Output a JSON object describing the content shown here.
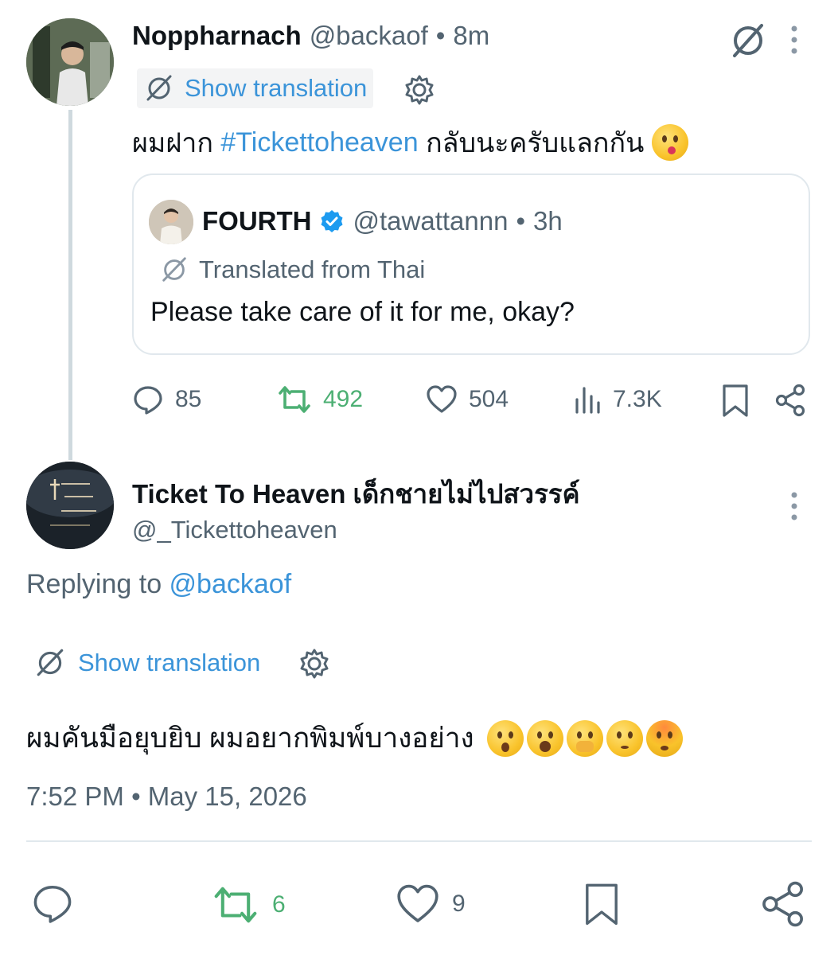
{
  "tweet1": {
    "display_name": "Noppharnach",
    "handle": "@backaof",
    "separator": "•",
    "time": "8m",
    "show_translation_label": "Show translation",
    "text_before_hashtag": "ผมฝาก ",
    "hashtag": "#Tickettoheaven",
    "text_after_hashtag": " กลับนะครับแลกกัน",
    "emoji": "kissing-face",
    "quote": {
      "display_name": "FOURTH",
      "handle": "@tawattannn",
      "separator": "•",
      "time": "3h",
      "translated_label": "Translated from Thai",
      "text": "Please take care of it for me, okay?"
    },
    "actions": {
      "replies": "85",
      "reposts": "492",
      "likes": "504",
      "views": "7.3K"
    }
  },
  "tweet2": {
    "display_name": "Ticket To Heaven เด็กชายไม่ไปสวรรค์",
    "handle": "@_Tickettoheaven",
    "replying_prefix": "Replying to ",
    "replying_handle": "@backaof",
    "show_translation_label": "Show translation",
    "text": "ผมคันมือยุบยิบ ผมอยากพิมพ์บางอย่าง",
    "emojis": [
      "dizzy-face",
      "astonished-face",
      "face-with-hand-over-mouth",
      "flushed-face",
      "exploding-head"
    ],
    "timestamp": "7:52 PM • May 15, 2026",
    "actions": {
      "reposts": "6",
      "likes": "9"
    }
  },
  "colors": {
    "link": "#3b94d9",
    "muted": "#536471",
    "repost_green": "#4caf73",
    "verified_blue": "#1d9bf0",
    "border": "#e1e8ed"
  }
}
